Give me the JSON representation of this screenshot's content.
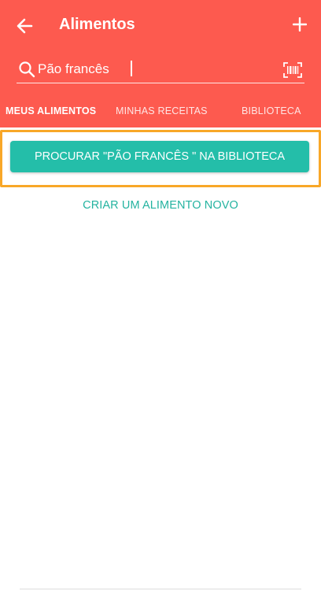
{
  "header": {
    "title": "Alimentos",
    "background_color": "#fd5a4f",
    "back_icon": "arrow-left-icon",
    "add_icon": "plus-icon"
  },
  "search": {
    "value": "Pão francês",
    "search_icon": "search-icon",
    "barcode_icon": "barcode-scan-icon"
  },
  "tabs": [
    {
      "label": "MEUS ALIMENTOS",
      "active": true
    },
    {
      "label": "MINHAS RECEITAS",
      "active": false
    },
    {
      "label": "BIBLIOTECA",
      "active": false
    }
  ],
  "main": {
    "search_library_label": "PROCURAR \"PÃO FRANCÊS \" NA BIBLIOTECA",
    "create_food_label": "CRIAR UM ALIMENTO NOVO",
    "accent_color": "#24bea9",
    "highlight_color": "#f8a728"
  }
}
